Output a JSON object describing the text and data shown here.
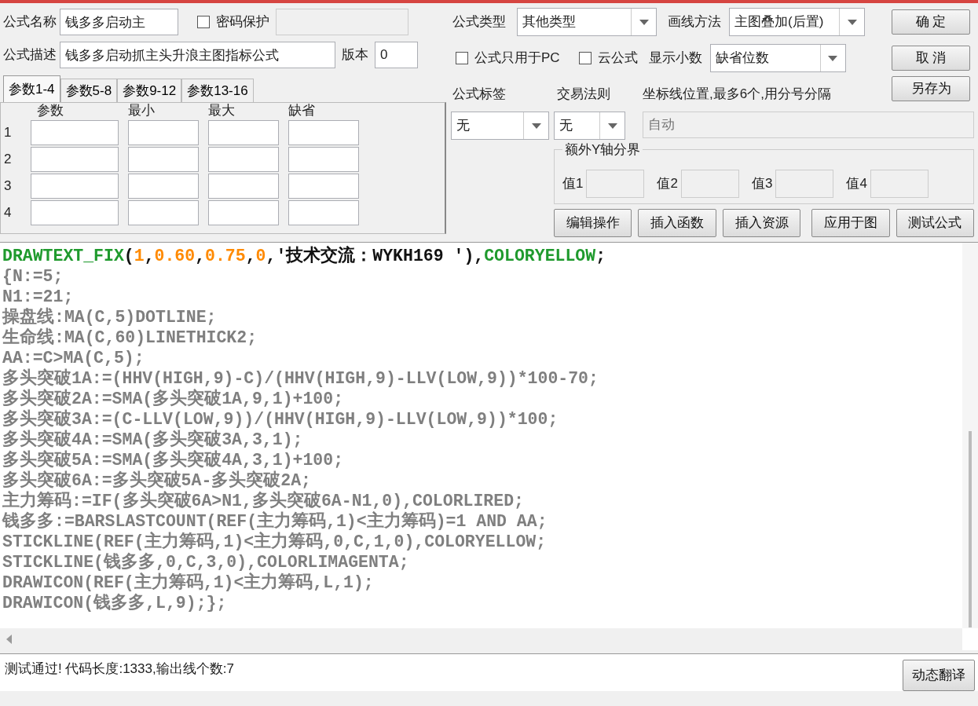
{
  "formula_name": {
    "label": "公式名称",
    "value": "钱多多启动主"
  },
  "password": {
    "label": "密码保护",
    "checked": false
  },
  "description": {
    "label": "公式描述",
    "value": "钱多多启动抓主头升浪主图指标公式"
  },
  "version": {
    "label": "版本",
    "value": "0"
  },
  "param_tabs": [
    {
      "label": "参数1-4",
      "selected": true
    },
    {
      "label": "参数5-8",
      "selected": false
    },
    {
      "label": "参数9-12",
      "selected": false
    },
    {
      "label": "参数13-16",
      "selected": false
    }
  ],
  "param_table": {
    "columns": [
      "参数",
      "最小",
      "最大",
      "缺省"
    ],
    "rows": [
      "1",
      "2",
      "3",
      "4"
    ]
  },
  "formula_type": {
    "label": "公式类型",
    "value": "其他类型"
  },
  "draw_method": {
    "label": "画线方法",
    "value": "主图叠加(后置)"
  },
  "options": [
    {
      "label": "公式只用于PC",
      "checked": false
    },
    {
      "label": "云公式",
      "checked": false
    }
  ],
  "decimals": {
    "label": "显示小数",
    "value": "缺省位数"
  },
  "formula_tag": {
    "label": "公式标签",
    "value": "无"
  },
  "trade_rule": {
    "label": "交易法则",
    "value": "无"
  },
  "axis_lines": {
    "label": "坐标线位置,最多6个,用分号分隔",
    "placeholder": "自动"
  },
  "extra_y": {
    "title": "额外Y轴分界",
    "fields": [
      "值1",
      "值2",
      "值3",
      "值4"
    ]
  },
  "side_buttons": [
    "确 定",
    "取 消",
    "另存为"
  ],
  "action_buttons": [
    "编辑操作",
    "插入函数",
    "插入资源",
    "应用于图",
    "测试公式"
  ],
  "code_lines": [
    [
      {
        "kind": "function",
        "text": "DRAWTEXT_FIX"
      },
      {
        "kind": "punct",
        "text": "("
      },
      {
        "kind": "number",
        "text": "1"
      },
      {
        "kind": "punct",
        "text": ","
      },
      {
        "kind": "number",
        "text": "0.60"
      },
      {
        "kind": "punct",
        "text": ","
      },
      {
        "kind": "number",
        "text": "0.75"
      },
      {
        "kind": "punct",
        "text": ","
      },
      {
        "kind": "number",
        "text": "0"
      },
      {
        "kind": "punct",
        "text": ",'技术交流：WYKH169 '),"
      },
      {
        "kind": "function",
        "text": "COLORYELLOW"
      },
      {
        "kind": "punct",
        "text": ";"
      }
    ],
    [
      {
        "kind": "plain",
        "text": "{N:=5;"
      }
    ],
    [
      {
        "kind": "plain",
        "text": "N1:=21;"
      }
    ],
    [
      {
        "kind": "plain",
        "text": "操盘线:MA(C,5)DOTLINE;"
      }
    ],
    [
      {
        "kind": "plain",
        "text": "生命线:MA(C,60)LINETHICK2;"
      }
    ],
    [
      {
        "kind": "plain",
        "text": "AA:=C>MA(C,5);"
      }
    ],
    [
      {
        "kind": "plain",
        "text": "多头突破1A:=(HHV(HIGH,9)-C)/(HHV(HIGH,9)-LLV(LOW,9))*100-70;"
      }
    ],
    [
      {
        "kind": "plain",
        "text": "多头突破2A:=SMA(多头突破1A,9,1)+100;"
      }
    ],
    [
      {
        "kind": "plain",
        "text": "多头突破3A:=(C-LLV(LOW,9))/(HHV(HIGH,9)-LLV(LOW,9))*100;"
      }
    ],
    [
      {
        "kind": "plain",
        "text": "多头突破4A:=SMA(多头突破3A,3,1);"
      }
    ],
    [
      {
        "kind": "plain",
        "text": "多头突破5A:=SMA(多头突破4A,3,1)+100;"
      }
    ],
    [
      {
        "kind": "plain",
        "text": "多头突破6A:=多头突破5A-多头突破2A;"
      }
    ],
    [
      {
        "kind": "plain",
        "text": "主力筹码:=IF(多头突破6A>N1,多头突破6A-N1,0),COLORLIRED;"
      }
    ],
    [
      {
        "kind": "plain",
        "text": "钱多多:=BARSLASTCOUNT(REF(主力筹码,1)<主力筹码)=1 AND AA;"
      }
    ],
    [
      {
        "kind": "plain",
        "text": "STICKLINE(REF(主力筹码,1)<主力筹码,0,C,1,0),COLORYELLOW;"
      }
    ],
    [
      {
        "kind": "plain",
        "text": "STICKLINE(钱多多,0,C,3,0),COLORLIMAGENTA;"
      }
    ],
    [
      {
        "kind": "plain",
        "text": "DRAWICON(REF(主力筹码,1)<主力筹码,L,1);"
      }
    ],
    [
      {
        "kind": "plain",
        "text": "DRAWICON(钱多多,L,9);};"
      }
    ]
  ],
  "status": {
    "message": "测试通过! 代码长度:1333,输出线个数:7",
    "button": "动态翻译"
  }
}
